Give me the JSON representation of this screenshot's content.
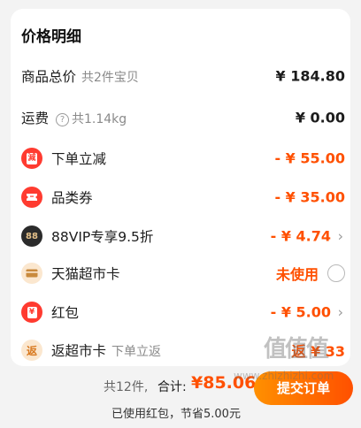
{
  "card": {
    "title": "价格明细"
  },
  "rows": {
    "goods_total": {
      "label": "商品总价",
      "sub": "共2件宝贝",
      "amount": "¥ 184.80"
    },
    "shipping": {
      "label": "运费",
      "help_glyph": "?",
      "sub": "共1.14kg",
      "amount": "¥ 0.00"
    },
    "order_discount": {
      "label": "下单立减",
      "amount": "- ¥ 55.00",
      "icon": "red-envelope-icon",
      "icon_glyph": "減"
    },
    "category_coupon": {
      "label": "品类券",
      "amount": "- ¥ 35.00",
      "icon": "coupon-ticket-icon"
    },
    "vip": {
      "label": "88VIP专享9.5折",
      "amount": "- ¥ 4.74",
      "icon": "88vip-badge-icon",
      "icon_glyph": "88"
    },
    "tmall_card": {
      "label": "天猫超市卡",
      "status": "未使用",
      "icon": "wallet-card-icon"
    },
    "red_packet": {
      "label": "红包",
      "amount": "- ¥ 5.00",
      "icon": "red-packet-icon",
      "icon_glyph": "¥"
    },
    "cashback": {
      "label": "返超市卡",
      "sub": "下单立返",
      "amount": "返 ¥ 33",
      "icon": "cashback-icon",
      "icon_glyph": "返"
    }
  },
  "footer": {
    "count": "共12件,",
    "total_label": "合计:",
    "total_value": "¥85.06",
    "saving_note": "已使用红包，节省5.00元",
    "submit_label": "提交订单"
  },
  "watermark": {
    "glyphs": "值值值",
    "url": "www.zhizhizhi.com"
  },
  "colors": {
    "accent": "#ff5000",
    "accent_light": "#ff9000",
    "vip_dark": "#2b2b2b",
    "card_beige": "#fbe7cf"
  }
}
